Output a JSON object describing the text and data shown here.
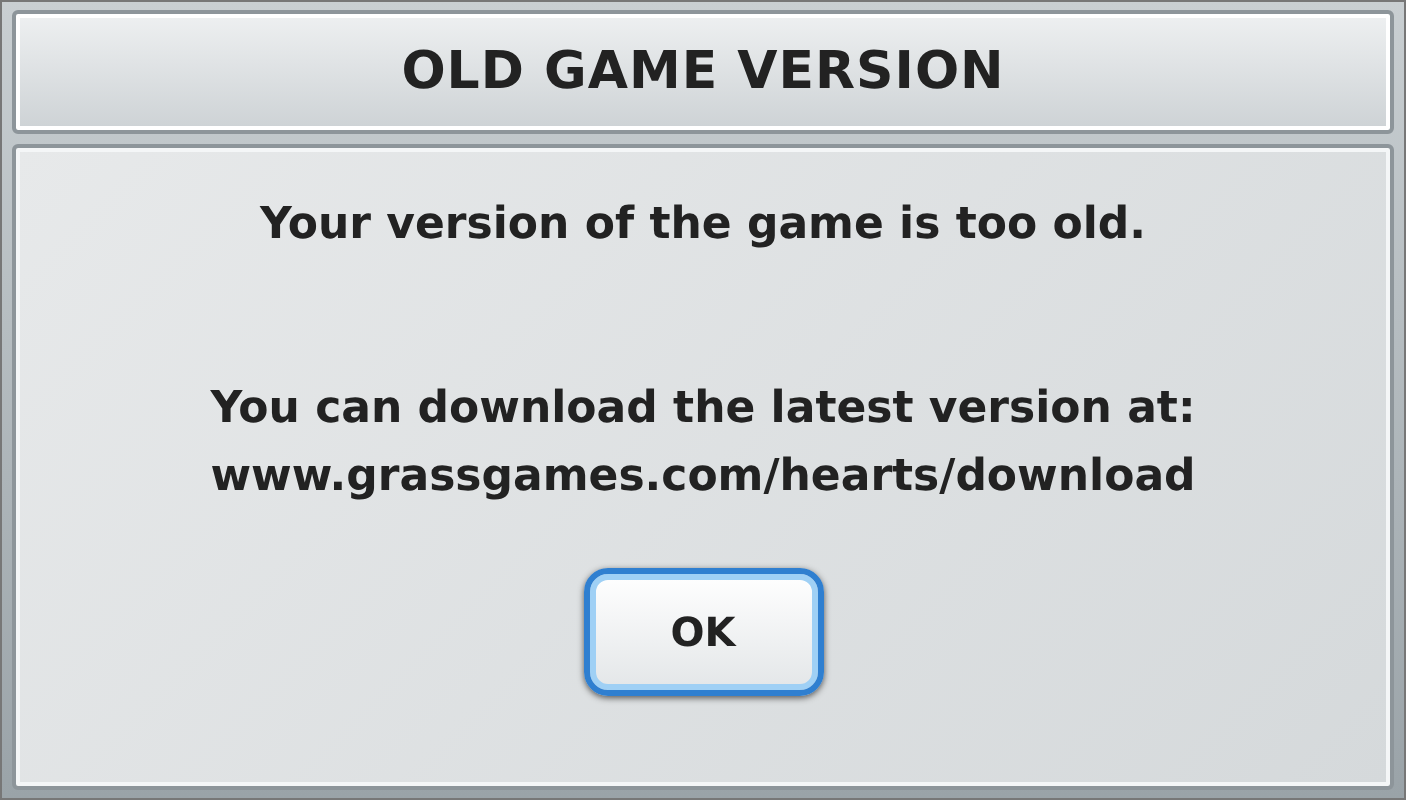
{
  "dialog": {
    "title": "OLD GAME VERSION",
    "lines": [
      "Your version of the game is too old.",
      "You can download the latest version at:",
      "www.grassgames.com/hearts/download"
    ],
    "buttons": [
      "OK"
    ]
  }
}
